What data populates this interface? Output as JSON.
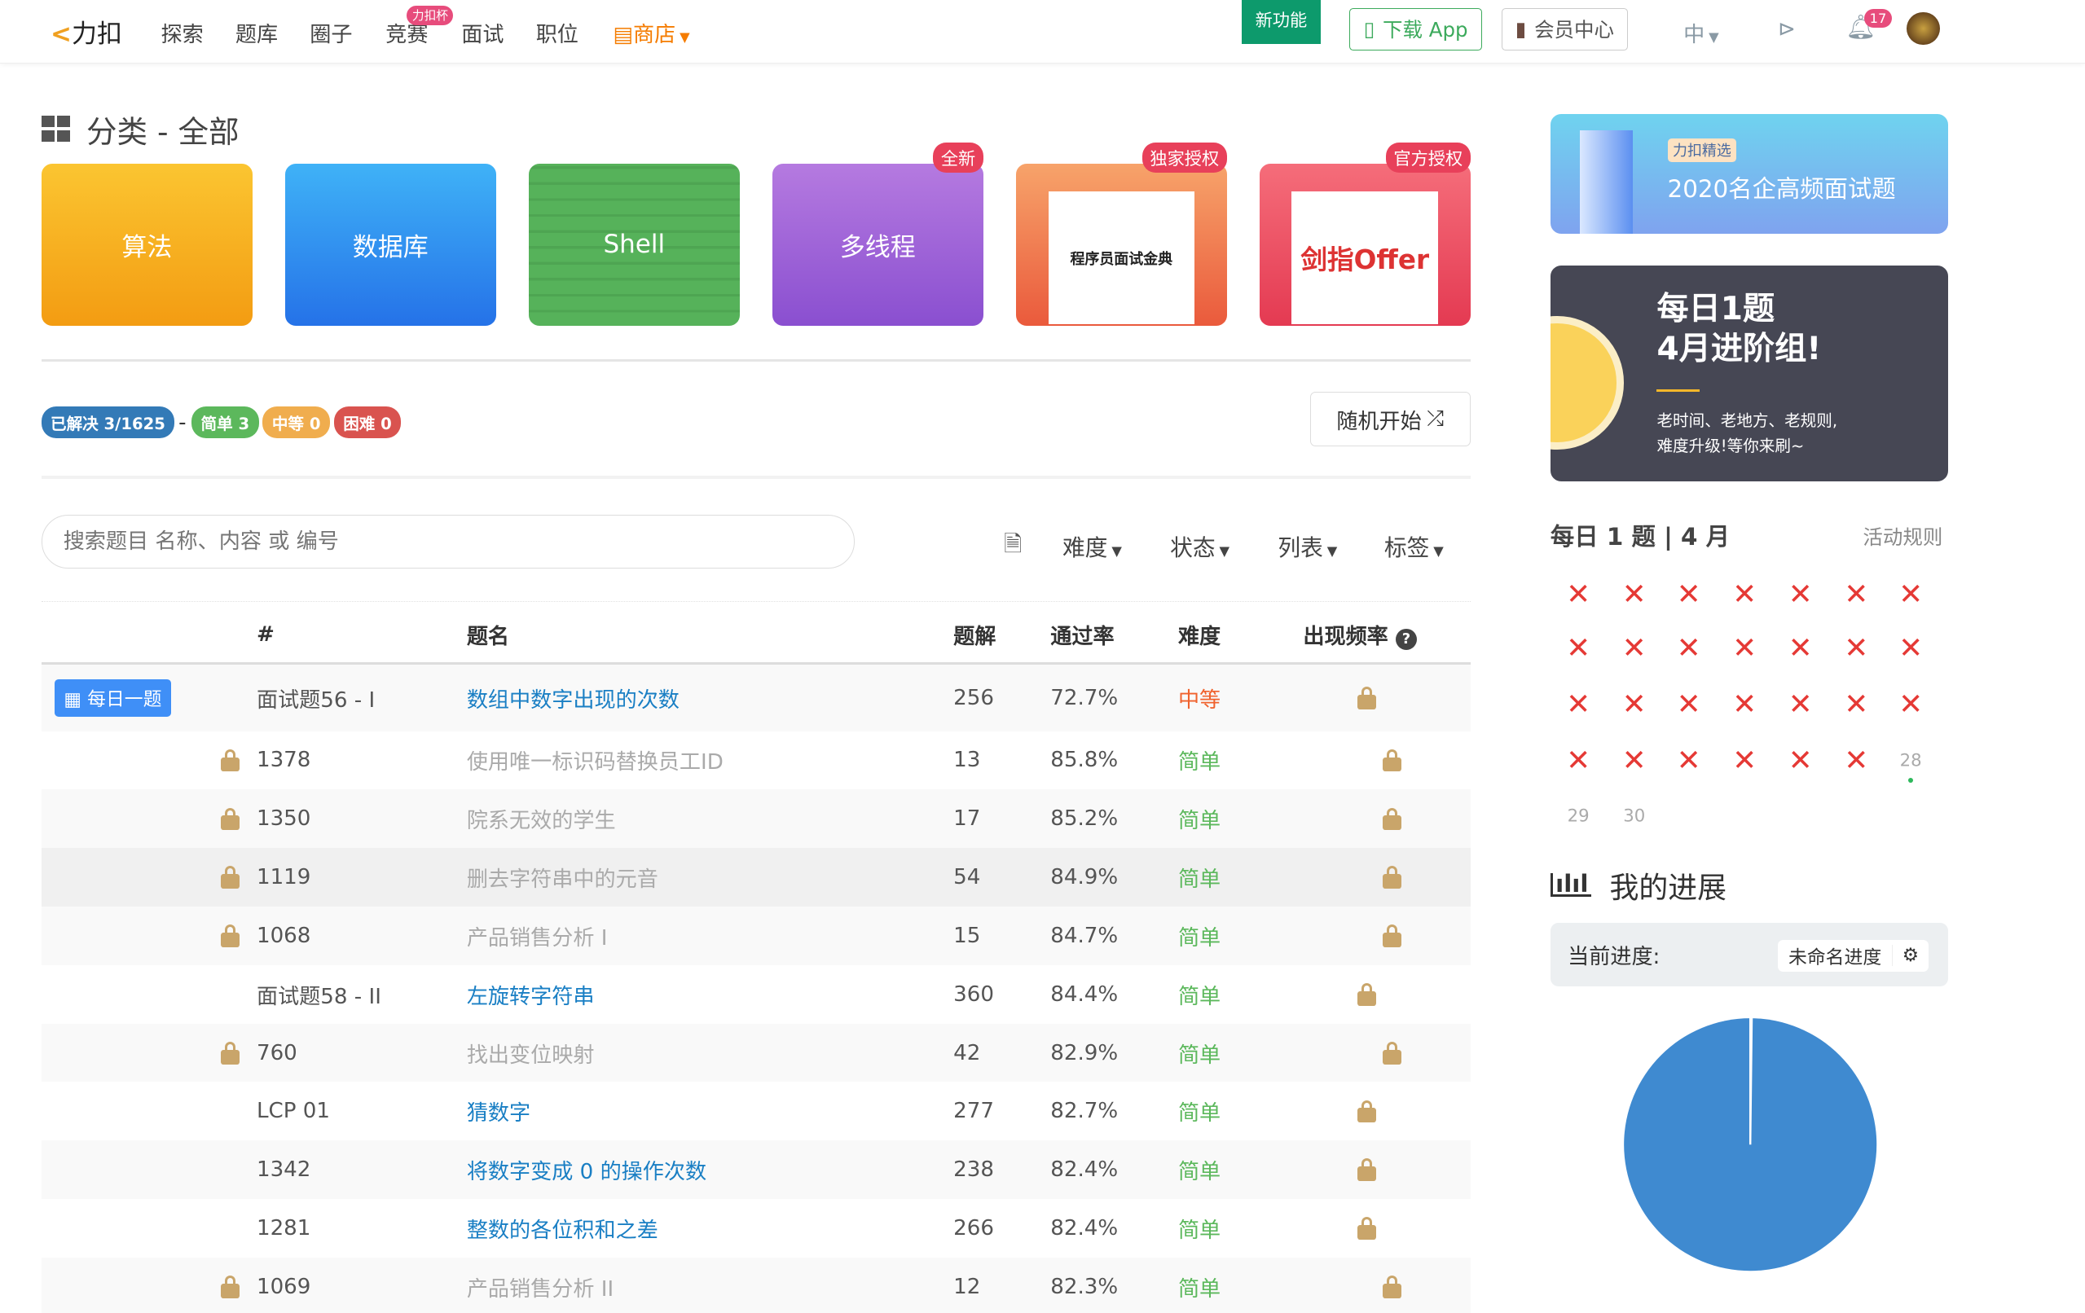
{
  "nav": {
    "logo": "力扣",
    "items": [
      "探索",
      "题库",
      "圈子",
      "竞赛",
      "面试",
      "职位"
    ],
    "contest_badge": "力扣杯",
    "store": "商店",
    "new_feature": "新功能",
    "download": "下载 App",
    "vip": "会员中心",
    "lang": "中",
    "notifications": "17"
  },
  "category": {
    "title": "分类 - 全部",
    "cards": [
      {
        "label": "算法",
        "tag": ""
      },
      {
        "label": "数据库",
        "tag": ""
      },
      {
        "label": "Shell",
        "tag": ""
      },
      {
        "label": "多线程",
        "tag": "全新"
      },
      {
        "label": "程序员面试金典",
        "tag": "独家授权"
      },
      {
        "label": "剑指Offer",
        "tag": "官方授权"
      }
    ]
  },
  "stats": {
    "solved": "已解决 3/1625",
    "sep": "-",
    "easy": "简单 3",
    "medium": "中等 0",
    "hard": "困难 0",
    "random": "随机开始"
  },
  "search": {
    "placeholder": "搜索题目 名称、内容 或 编号"
  },
  "filters": [
    "难度",
    "状态",
    "列表",
    "标签"
  ],
  "table": {
    "headers": [
      "#",
      "题名",
      "题解",
      "通过率",
      "难度",
      "出现频率"
    ],
    "daily_label": "每日一题",
    "rows": [
      {
        "id": "面试题56 - I",
        "title": "数组中数字出现的次数",
        "solutions": "256",
        "rate": "72.7%",
        "difficulty": "中等",
        "locked": false,
        "daily": true
      },
      {
        "id": "1378",
        "title": "使用唯一标识码替换员工ID",
        "solutions": "13",
        "rate": "85.8%",
        "difficulty": "简单",
        "locked": true
      },
      {
        "id": "1350",
        "title": "院系无效的学生",
        "solutions": "17",
        "rate": "85.2%",
        "difficulty": "简单",
        "locked": true
      },
      {
        "id": "1119",
        "title": "删去字符串中的元音",
        "solutions": "54",
        "rate": "84.9%",
        "difficulty": "简单",
        "locked": true
      },
      {
        "id": "1068",
        "title": "产品销售分析 I",
        "solutions": "15",
        "rate": "84.7%",
        "difficulty": "简单",
        "locked": true
      },
      {
        "id": "面试题58 - II",
        "title": "左旋转字符串",
        "solutions": "360",
        "rate": "84.4%",
        "difficulty": "简单",
        "locked": false
      },
      {
        "id": "760",
        "title": "找出变位映射",
        "solutions": "42",
        "rate": "82.9%",
        "difficulty": "简单",
        "locked": true
      },
      {
        "id": "LCP 01",
        "title": "猜数字",
        "solutions": "277",
        "rate": "82.7%",
        "difficulty": "简单",
        "locked": false
      },
      {
        "id": "1342",
        "title": "将数字变成 0 的操作次数",
        "solutions": "238",
        "rate": "82.4%",
        "difficulty": "简单",
        "locked": false
      },
      {
        "id": "1281",
        "title": "整数的各位积和之差",
        "solutions": "266",
        "rate": "82.4%",
        "difficulty": "简单",
        "locked": false
      },
      {
        "id": "1069",
        "title": "产品销售分析 II",
        "solutions": "12",
        "rate": "82.3%",
        "difficulty": "简单",
        "locked": true
      }
    ]
  },
  "banners": {
    "b1_tag": "力扣精选",
    "b1_title": "2020名企高频面试题",
    "b2_line1": "每日1题",
    "b2_line2": "4月进阶组!",
    "b2_desc1": "老时间、老地方、老规则,",
    "b2_desc2": "难度升级!等你来刷~"
  },
  "calendar": {
    "title": "每日 1 题 | 4 月",
    "rules": "活动规则",
    "missed_days": 27,
    "days": [
      "28",
      "29",
      "30"
    ]
  },
  "progress": {
    "title": "我的进展",
    "current_label": "当前进度:",
    "session": "未命名进度",
    "solved": 3,
    "total": 1625
  },
  "colors": {
    "accent": "#2d8fd5",
    "easy": "#5cb85c",
    "medium": "#f0ad4e",
    "hard": "#d9534f",
    "pie": "#3f8ad0"
  }
}
